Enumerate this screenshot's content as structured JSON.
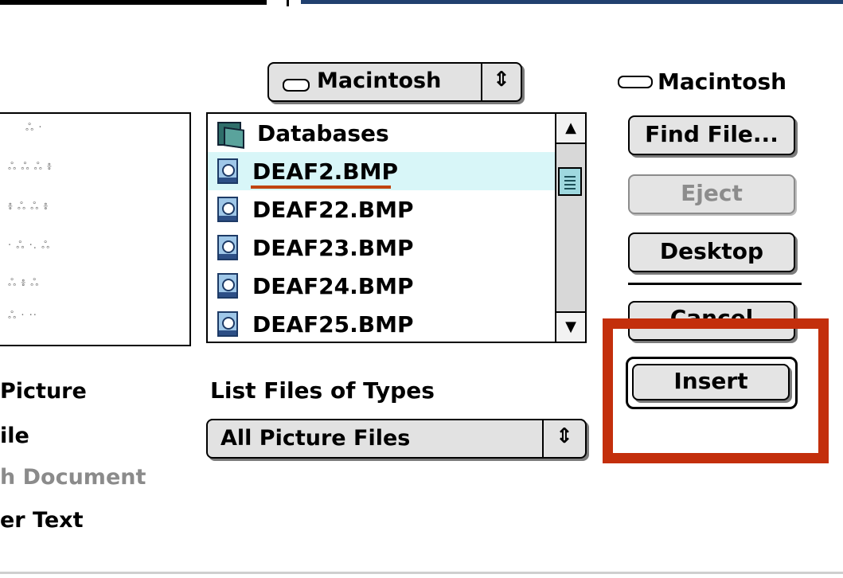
{
  "volume_popup": {
    "label": "Macintosh",
    "arrows": "⇕"
  },
  "file_list": {
    "items": [
      {
        "name": "Databases",
        "type": "folder"
      },
      {
        "name": "DEAF2.BMP",
        "type": "file",
        "selected": true
      },
      {
        "name": "DEAF22.BMP",
        "type": "file"
      },
      {
        "name": "DEAF23.BMP",
        "type": "file"
      },
      {
        "name": "DEAF24.BMP",
        "type": "file"
      },
      {
        "name": "DEAF25.BMP",
        "type": "file"
      }
    ],
    "scroll_up": "▲",
    "scroll_down": "▼"
  },
  "volume_name": "Macintosh",
  "buttons": {
    "find_file": "Find File...",
    "eject": "Eject",
    "desktop": "Desktop",
    "cancel": "Cancel",
    "insert": "Insert"
  },
  "left_options": [
    "Picture",
    "ile",
    "h Document",
    "er Text"
  ],
  "file_types": {
    "title": "List Files of Types",
    "selected": "All Picture Files",
    "arrows": "⇕"
  },
  "colors": {
    "highlight": "#c32f0c",
    "selection": "#d8f6f8"
  }
}
